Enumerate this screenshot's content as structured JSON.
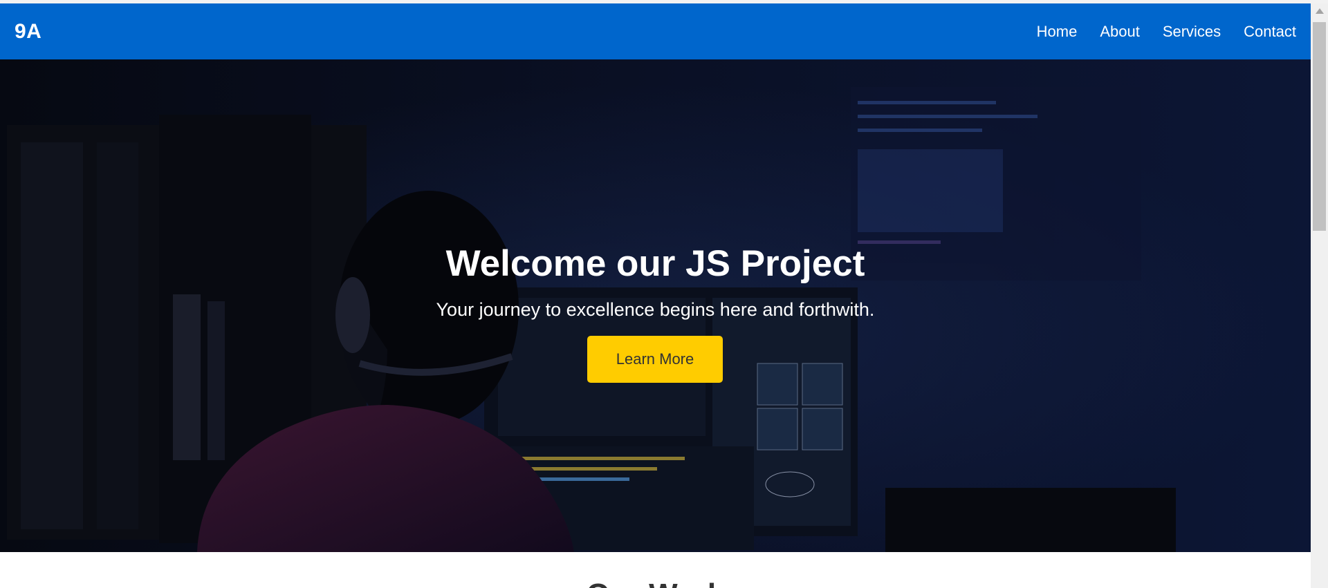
{
  "nav": {
    "logo": "9A",
    "links": [
      "Home",
      "About",
      "Services",
      "Contact"
    ]
  },
  "hero": {
    "title": "Welcome our JS Project",
    "subtitle": "Your journey to excellence begins here and forthwith.",
    "button": "Learn More"
  },
  "section": {
    "title": "Our Work"
  },
  "colors": {
    "navbar": "#0066cc",
    "cta": "#ffcc00",
    "hero_overlay": "#05070f"
  }
}
